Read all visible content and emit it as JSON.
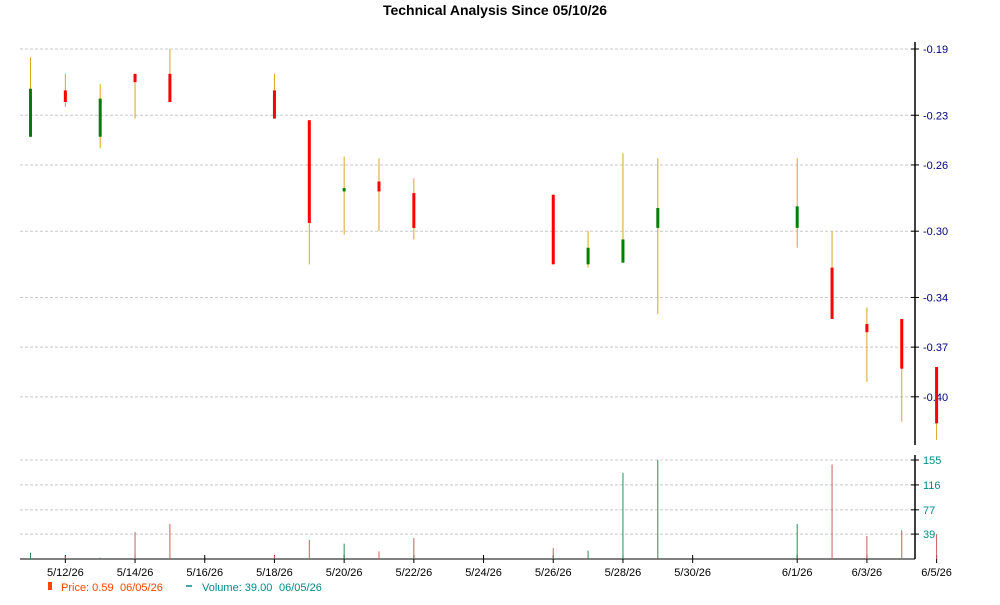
{
  "chart_data": {
    "type": "candlestick",
    "title": "Technical Analysis Since 05/10/26",
    "x_tick_labels": [
      "5/12/26",
      "5/14/26",
      "5/16/26",
      "5/18/26",
      "5/20/26",
      "5/22/26",
      "5/24/26",
      "5/26/26",
      "5/28/26",
      "5/30/26",
      "6/1/26",
      "6/3/26",
      "6/5/26"
    ],
    "price_axis": {
      "ticks": [
        "-0.19",
        "-0.23",
        "-0.26",
        "-0.30",
        "-0.34",
        "-0.37",
        "-0.40"
      ],
      "ylim": [
        -0.43,
        -0.19
      ]
    },
    "volume_axis": {
      "ticks": [
        "155",
        "116",
        "77",
        "39"
      ],
      "ylim": [
        0,
        155
      ]
    },
    "colors": {
      "up": "#008000",
      "down": "#ff0000",
      "wick": "#daa520",
      "axis": "#000080",
      "volume_up": "#2e8b57",
      "volume_down": "#cd5c5c"
    },
    "candles": [
      {
        "date": "5/11/26",
        "open": -0.243,
        "high": -0.195,
        "low": -0.243,
        "close": -0.214,
        "volume": 10
      },
      {
        "date": "5/12/26",
        "open": -0.215,
        "high": -0.205,
        "low": -0.225,
        "close": -0.222,
        "volume": 4
      },
      {
        "date": "5/13/26",
        "open": -0.243,
        "high": -0.211,
        "low": -0.25,
        "close": -0.22,
        "volume": 2
      },
      {
        "date": "5/14/26",
        "open": -0.205,
        "high": -0.205,
        "low": -0.232,
        "close": -0.21,
        "volume": 42
      },
      {
        "date": "5/15/26",
        "open": -0.205,
        "high": -0.19,
        "low": -0.222,
        "close": -0.222,
        "volume": 55
      },
      {
        "date": "5/18/26",
        "open": -0.215,
        "high": -0.205,
        "low": -0.232,
        "close": -0.232,
        "volume": 6
      },
      {
        "date": "5/19/26",
        "open": -0.233,
        "high": -0.233,
        "low": -0.32,
        "close": -0.295,
        "volume": 30
      },
      {
        "date": "5/20/26",
        "open": -0.276,
        "high": -0.255,
        "low": -0.302,
        "close": -0.274,
        "volume": 24
      },
      {
        "date": "5/21/26",
        "open": -0.27,
        "high": -0.256,
        "low": -0.3,
        "close": -0.276,
        "volume": 12
      },
      {
        "date": "5/22/26",
        "open": -0.277,
        "high": -0.268,
        "low": -0.305,
        "close": -0.298,
        "volume": 33
      },
      {
        "date": "5/26/26",
        "open": -0.278,
        "high": -0.278,
        "low": -0.32,
        "close": -0.32,
        "volume": 17
      },
      {
        "date": "5/27/26",
        "open": -0.32,
        "high": -0.3,
        "low": -0.322,
        "close": -0.31,
        "volume": 13
      },
      {
        "date": "5/28/26",
        "open": -0.319,
        "high": -0.253,
        "low": -0.319,
        "close": -0.305,
        "volume": 135
      },
      {
        "date": "5/29/26",
        "open": -0.298,
        "high": -0.256,
        "low": -0.35,
        "close": -0.286,
        "volume": 155
      },
      {
        "date": "6/1/26",
        "open": -0.298,
        "high": -0.256,
        "low": -0.31,
        "close": -0.285,
        "volume": 55
      },
      {
        "date": "6/2/26",
        "open": -0.322,
        "high": -0.3,
        "low": -0.353,
        "close": -0.353,
        "volume": 148
      },
      {
        "date": "6/3/26",
        "open": -0.356,
        "high": -0.346,
        "low": -0.391,
        "close": -0.361,
        "volume": 36
      },
      {
        "date": "6/4/26",
        "open": -0.353,
        "high": -0.353,
        "low": -0.415,
        "close": -0.383,
        "volume": 45
      },
      {
        "date": "6/5/26",
        "open": -0.382,
        "high": -0.382,
        "low": -0.426,
        "close": -0.416,
        "volume": 39
      }
    ],
    "legend": {
      "price_label": "Price: 0.59",
      "price_date": "06/05/26",
      "volume_label": "Volume: 39.00",
      "volume_date": "06/05/26"
    }
  }
}
